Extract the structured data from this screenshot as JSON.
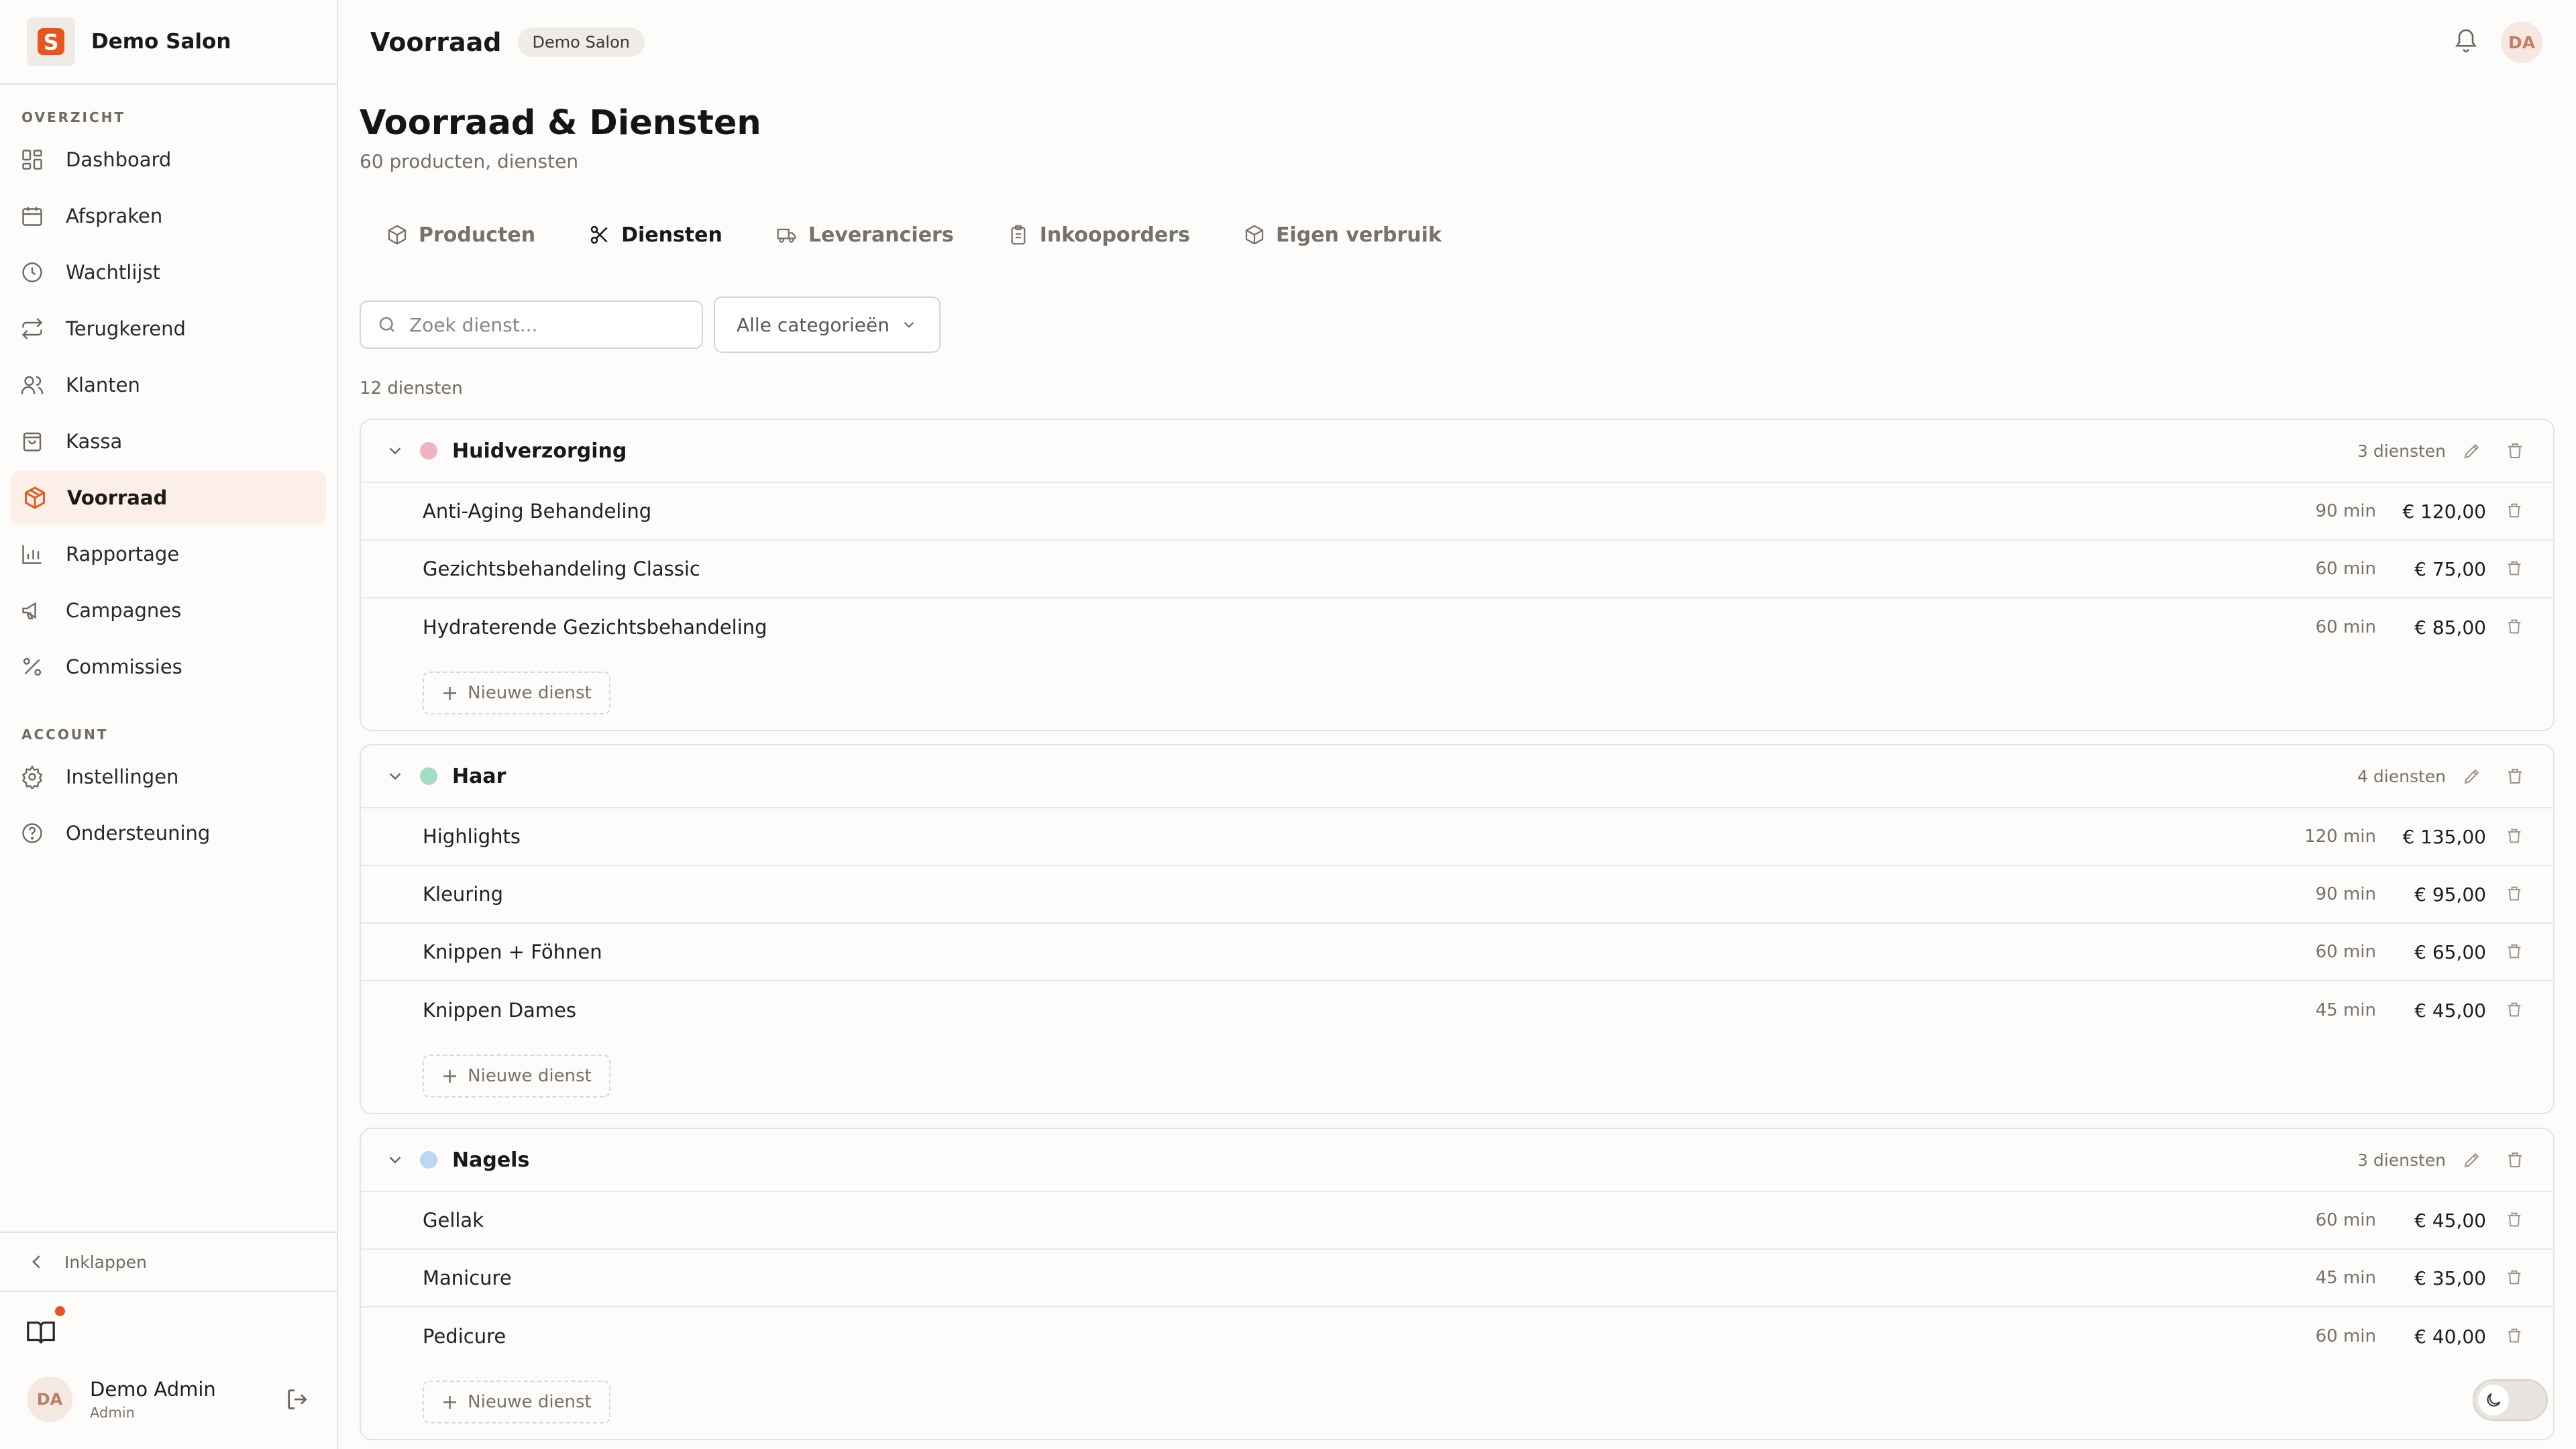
{
  "brand": {
    "name": "Demo Salon",
    "logo_letter": "S",
    "accent": "#e8541e"
  },
  "sidebar": {
    "section_overview": "OVERZICHT",
    "section_account": "ACCOUNT",
    "items": [
      {
        "label": "Dashboard",
        "icon": "grid-icon"
      },
      {
        "label": "Afspraken",
        "icon": "calendar-icon"
      },
      {
        "label": "Wachtlijst",
        "icon": "clock-icon"
      },
      {
        "label": "Terugkerend",
        "icon": "repeat-icon"
      },
      {
        "label": "Klanten",
        "icon": "users-icon"
      },
      {
        "label": "Kassa",
        "icon": "shopping-bag-icon"
      },
      {
        "label": "Voorraad",
        "icon": "package-icon",
        "active": true
      },
      {
        "label": "Rapportage",
        "icon": "bar-chart-icon"
      },
      {
        "label": "Campagnes",
        "icon": "megaphone-icon"
      },
      {
        "label": "Commissies",
        "icon": "percent-icon"
      }
    ],
    "account_items": [
      {
        "label": "Instellingen",
        "icon": "gear-icon"
      },
      {
        "label": "Ondersteuning",
        "icon": "help-circle-icon"
      }
    ],
    "collapse_label": "Inklappen",
    "user": {
      "initials": "DA",
      "name": "Demo Admin",
      "role": "Admin"
    }
  },
  "topbar": {
    "title": "Voorraad",
    "badge": "Demo Salon",
    "avatar_initials": "DA"
  },
  "page": {
    "title": "Voorraad & Diensten",
    "subtitle": "60 producten, diensten"
  },
  "tabs": [
    {
      "label": "Producten",
      "icon": "package-icon"
    },
    {
      "label": "Diensten",
      "icon": "scissors-icon",
      "active": true
    },
    {
      "label": "Leveranciers",
      "icon": "truck-icon"
    },
    {
      "label": "Inkooporders",
      "icon": "clipboard-icon"
    },
    {
      "label": "Eigen verbruik",
      "icon": "package-icon"
    }
  ],
  "search": {
    "placeholder": "Zoek dienst...",
    "value": ""
  },
  "filter": {
    "selected": "Alle categorieën"
  },
  "count_label": "12 diensten",
  "add_label": "Nieuwe dienst",
  "groups": [
    {
      "name": "Huidverzorging",
      "color": "#f0b3c4",
      "count": "3 diensten",
      "services": [
        {
          "name": "Anti-Aging Behandeling",
          "duration": "90 min",
          "price": "€ 120,00"
        },
        {
          "name": "Gezichtsbehandeling Classic",
          "duration": "60 min",
          "price": "€ 75,00"
        },
        {
          "name": "Hydraterende Gezichtsbehandeling",
          "duration": "60 min",
          "price": "€ 85,00"
        }
      ]
    },
    {
      "name": "Haar",
      "color": "#a5dcc5",
      "count": "4 diensten",
      "services": [
        {
          "name": "Highlights",
          "duration": "120 min",
          "price": "€ 135,00"
        },
        {
          "name": "Kleuring",
          "duration": "90 min",
          "price": "€ 95,00"
        },
        {
          "name": "Knippen + Föhnen",
          "duration": "60 min",
          "price": "€ 65,00"
        },
        {
          "name": "Knippen Dames",
          "duration": "45 min",
          "price": "€ 45,00"
        }
      ]
    },
    {
      "name": "Nagels",
      "color": "#b9d7f3",
      "count": "3 diensten",
      "services": [
        {
          "name": "Gellak",
          "duration": "60 min",
          "price": "€ 45,00"
        },
        {
          "name": "Manicure",
          "duration": "45 min",
          "price": "€ 35,00"
        },
        {
          "name": "Pedicure",
          "duration": "60 min",
          "price": "€ 40,00"
        }
      ]
    }
  ]
}
